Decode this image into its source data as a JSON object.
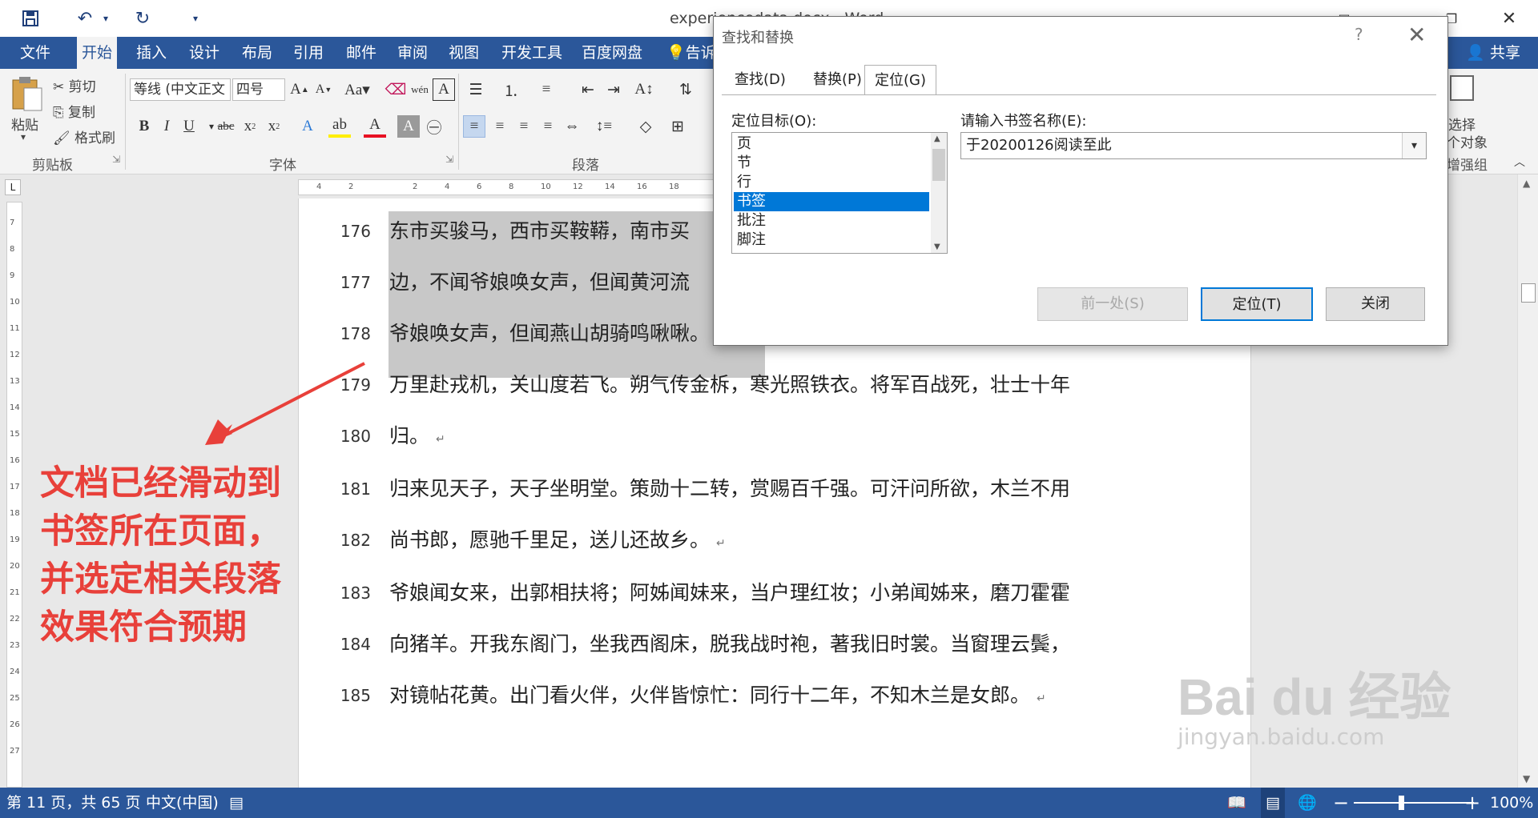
{
  "title_bar": {
    "doc_title": "experiencedata.docx - Word",
    "save_icon": "save-icon",
    "undo_icon": "undo-icon",
    "redo_icon": "redo-icon"
  },
  "tabs": {
    "file": "文件",
    "items": [
      "开始",
      "插入",
      "设计",
      "布局",
      "引用",
      "邮件",
      "审阅",
      "视图",
      "开发工具",
      "百度网盘",
      "告诉"
    ],
    "share": "共享"
  },
  "ribbon": {
    "clipboard": {
      "paste": "粘贴",
      "cut": "剪切",
      "copy": "复制",
      "format_painter": "格式刷",
      "group": "剪贴板"
    },
    "font": {
      "font_name": "等线 (中文正文",
      "font_size": "四号",
      "group": "字体"
    },
    "paragraph": {
      "group": "段落"
    },
    "editing": {
      "select": "选择",
      "objects": "个对象",
      "group": "增强组"
    }
  },
  "ruler": {
    "h_ticks": [
      "4",
      "2",
      "",
      "2",
      "4",
      "6",
      "8",
      "10",
      "12",
      "14",
      "16",
      "18"
    ],
    "v_ticks": [
      "7",
      "8",
      "9",
      "10",
      "11",
      "12",
      "13",
      "14",
      "15",
      "16",
      "17",
      "18",
      "19",
      "20",
      "21",
      "22",
      "23",
      "24",
      "25",
      "26",
      "27"
    ]
  },
  "document": {
    "lines": [
      {
        "num": "176",
        "text": "东市买骏马，西市买鞍鞯，南市买"
      },
      {
        "num": "177",
        "text": "边，不闻爷娘唤女声，但闻黄河流"
      },
      {
        "num": "178",
        "text": "爷娘唤女声，但闻燕山胡骑鸣啾啾。"
      },
      {
        "num": "179",
        "text": "万里赴戎机，关山度若飞。朔气传金柝，寒光照铁衣。将军百战死，壮士十年"
      },
      {
        "num": "180",
        "text": "归。"
      },
      {
        "num": "181",
        "text": "归来见天子，天子坐明堂。策勋十二转，赏赐百千强。可汗问所欲，木兰不用"
      },
      {
        "num": "182",
        "text": "尚书郎，愿驰千里足，送儿还故乡。"
      },
      {
        "num": "183",
        "text": "爷娘闻女来，出郭相扶将；阿姊闻妹来，当户理红妆；小弟闻姊来，磨刀霍霍"
      },
      {
        "num": "184",
        "text": "向猪羊。开我东阁门，坐我西阁床，脱我战时袍，著我旧时裳。当窗理云鬓，"
      },
      {
        "num": "185",
        "text": "对镜帖花黄。出门看火伴，火伴皆惊忙：同行十二年，不知木兰是女郎。"
      }
    ],
    "paragraph_mark": "↵"
  },
  "annotation": {
    "lines": [
      "文档已经滑动到",
      "书签所在页面，",
      "并选定相关段落",
      "效果符合预期"
    ],
    "color": "#e8403a"
  },
  "status": {
    "page": "第 11 页，共 65 页",
    "language": "中文(中国)",
    "zoom": "100%",
    "zoom_minus": "−",
    "zoom_plus": "+"
  },
  "dialog": {
    "title": "查找和替换",
    "help": "?",
    "close": "✕",
    "tabs": [
      "查找(D)",
      "替换(P)",
      "定位(G)"
    ],
    "active_tab": "定位(G)",
    "target_label": "定位目标(O):",
    "targets": [
      "页",
      "节",
      "行",
      "书签",
      "批注",
      "脚注"
    ],
    "selected_target": "书签",
    "bookmark_label": "请输入书签名称(E):",
    "bookmark_value": "于20200126阅读至此",
    "buttons": {
      "previous": "前一处(S)",
      "goto": "定位(T)",
      "close": "关闭"
    }
  },
  "watermark": {
    "main": "Bai du 经验",
    "sub": "jingyan.baidu.com"
  },
  "colors": {
    "word_blue": "#2b579a",
    "selection": "#0078d7",
    "highlight": "#c8c8c8"
  }
}
